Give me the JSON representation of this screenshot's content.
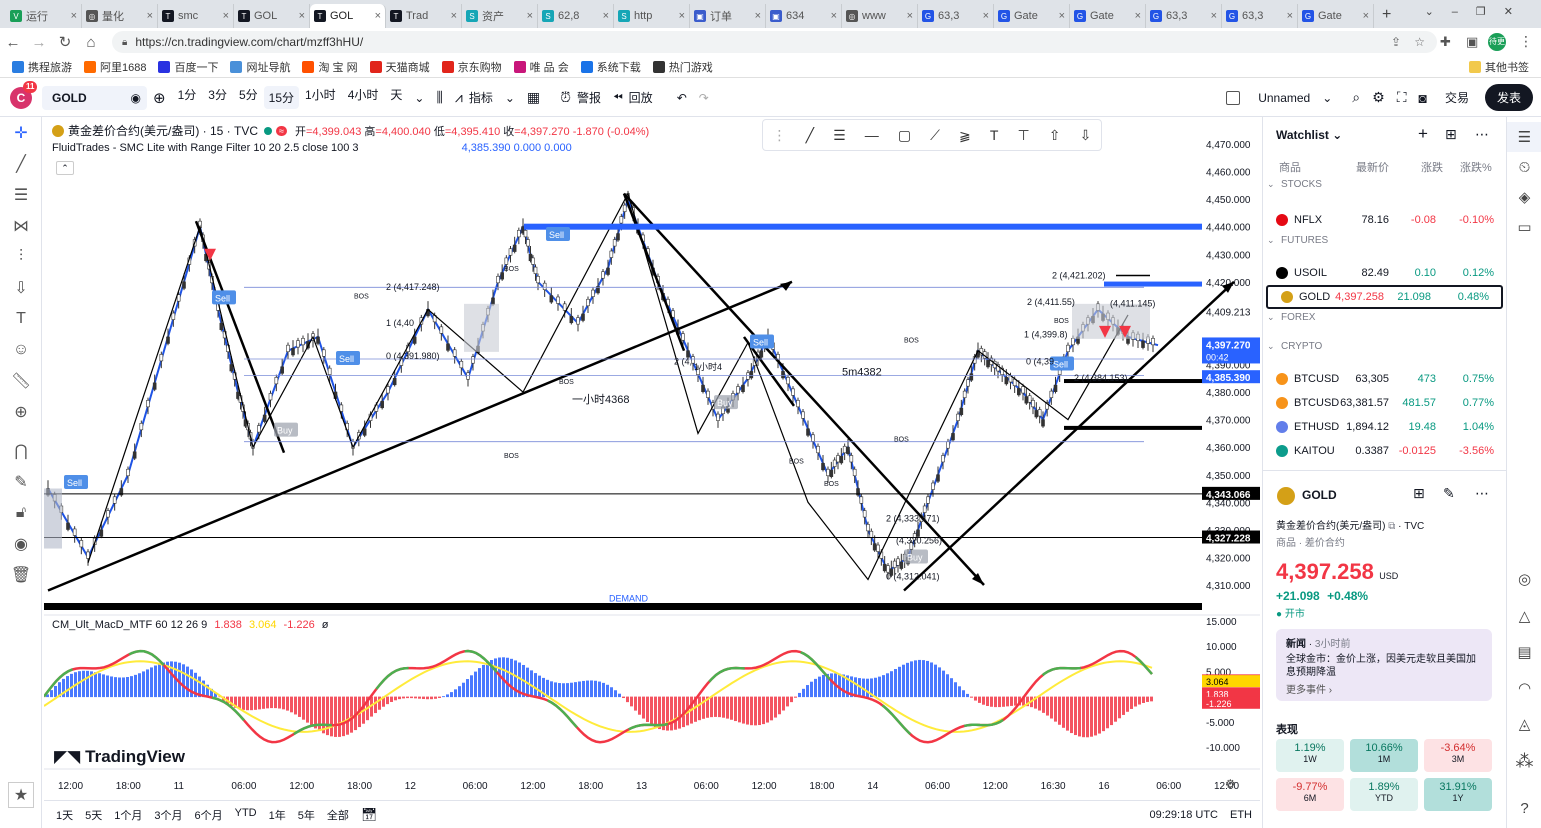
{
  "browser": {
    "tabs": [
      {
        "label": "运行",
        "color": "#1a9f58",
        "glyph": "V"
      },
      {
        "label": "量化",
        "color": "#555",
        "glyph": "◎"
      },
      {
        "label": "smc",
        "color": "#131722",
        "glyph": "T"
      },
      {
        "label": "GOL",
        "color": "#131722",
        "glyph": "T"
      },
      {
        "label": "GOL",
        "color": "#131722",
        "glyph": "T",
        "active": true
      },
      {
        "label": "Trad",
        "color": "#131722",
        "glyph": "T"
      },
      {
        "label": "资产",
        "color": "#16a6b6",
        "glyph": "S"
      },
      {
        "label": "62,8",
        "color": "#16a6b6",
        "glyph": "S"
      },
      {
        "label": "http",
        "color": "#16a6b6",
        "glyph": "S"
      },
      {
        "label": "订单",
        "color": "#3a5ccc",
        "glyph": "▣"
      },
      {
        "label": "634",
        "color": "#3a5ccc",
        "glyph": "▣"
      },
      {
        "label": "www",
        "color": "#555",
        "glyph": "◎"
      },
      {
        "label": "63,3",
        "color": "#2354e6",
        "glyph": "G"
      },
      {
        "label": "Gate",
        "color": "#2354e6",
        "glyph": "G"
      },
      {
        "label": "Gate",
        "color": "#2354e6",
        "glyph": "G"
      },
      {
        "label": "63,3",
        "color": "#2354e6",
        "glyph": "G"
      },
      {
        "label": "63,3",
        "color": "#2354e6",
        "glyph": "G"
      },
      {
        "label": "Gate",
        "color": "#2354e6",
        "glyph": "G"
      }
    ],
    "url": "https://cn.tradingview.com/chart/mzff3hHU/",
    "bookmarks": [
      "携程旅游",
      "阿里1688",
      "百度一下",
      "网址导航",
      "淘 宝 网",
      "天猫商城",
      "京东购物",
      "唯 品 会",
      "系统下载",
      "热门游戏"
    ],
    "bookmarks_other": "其他书签",
    "profile": "待更"
  },
  "toolbar": {
    "badge": "11",
    "symbol": "GOLD",
    "intervals": [
      "1分",
      "3分",
      "5分",
      "15分",
      "1小时",
      "4小时",
      "天"
    ],
    "indicators": "指标",
    "alert": "警报",
    "replay": "回放",
    "layout_name": "Unnamed",
    "trade": "交易",
    "publish": "发表"
  },
  "chart": {
    "title": "黄金差价合约(美元/盎司) · 15 · TVC",
    "ohlc": {
      "o_label": "开",
      "o": "=4,399.043",
      "h_label": "高",
      "h": "=4,400.040",
      "l_label": "低",
      "l": "=4,395.410",
      "c_label": "收",
      "c": "=4,397.270",
      "chg": "-1.870 (-0.04%)"
    },
    "indicator1": "FluidTrades - SMC Lite with Range Filter 10 20 2.5 close 100 3",
    "indicator1_vals": "4,385.390  0.000  0.000",
    "price_ticks": [
      "4,470.000",
      "4,460.000",
      "4,450.000",
      "4,440.000",
      "4,430.000",
      "4,420.000",
      "4,409.213",
      "4,397.302",
      "4,390.000",
      "4,380.000",
      "4,370.000",
      "4,360.000",
      "4,350.000",
      "4,340.000",
      "4,330.000",
      "4,320.000",
      "4,310.000"
    ],
    "price_labels": [
      {
        "text": "4,397.270",
        "sub": "00:42",
        "bg": "#2962ff"
      },
      {
        "text": "4,385.390",
        "bg": "#2962ff"
      },
      {
        "text": "4,343.066",
        "bg": "#000000"
      },
      {
        "text": "4,327.228",
        "bg": "#000000"
      }
    ],
    "annotations": [
      "2 (4,421.202)",
      "2 (4,411.55)",
      "(4,411.145)",
      "1 (4,399.8)",
      "0 (4,39",
      "2 (4,384.153)",
      "2 (4,417.248)",
      "1 (4,40",
      "0 (4,391.980)",
      "5m4382",
      "一小时4368",
      "2 (4,",
      "1小时4",
      "2 (4,333.471)",
      "(4,320.256)",
      "0 (4,312.041)",
      "DEMAND"
    ],
    "labels_bos": "BOS",
    "labels_sell": "Sell",
    "labels_buy": "Buy",
    "macd_title": "CM_Ult_MacD_MTF 60 12 26 9",
    "macd_vals": [
      "1.838",
      "3.064",
      "-1.226",
      "ø"
    ],
    "macd_ticks": [
      "15.000",
      "10.000",
      "5.000",
      "0.000",
      "-5.000",
      "-10.000"
    ],
    "macd_labels": [
      {
        "text": "3.219",
        "bg": "#f23645"
      },
      {
        "text": "3.064",
        "bg": "#ffd600",
        "fg": "#000"
      },
      {
        "text": "1.838",
        "bg": "#f23645"
      },
      {
        "text": "-1.226",
        "bg": "#f23645"
      }
    ],
    "time_ticks": [
      "12:00",
      "18:00",
      "11",
      "06:00",
      "12:00",
      "18:00",
      "12",
      "06:00",
      "12:00",
      "18:00",
      "13",
      "06:00",
      "12:00",
      "18:00",
      "14",
      "06:00",
      "12:00",
      "16:30",
      "16",
      "06:00",
      "12:00"
    ],
    "logo": "TradingView"
  },
  "bottom": {
    "ranges": [
      "1天",
      "5天",
      "1个月",
      "3个月",
      "6个月",
      "YTD",
      "1年",
      "5年",
      "全部"
    ],
    "clock": "09:29:18 UTC",
    "currency": "ETH"
  },
  "watchlist": {
    "title": "Watchlist",
    "cols": [
      "商品",
      "最新价",
      "涨跌",
      "涨跌%"
    ],
    "sections": {
      "stocks": "STOCKS",
      "futures": "FUTURES",
      "forex": "FOREX",
      "crypto": "CRYPTO"
    },
    "rows": [
      {
        "sym": "NFLX",
        "last": "78.16",
        "chg": "-0.08",
        "pct": "-0.10%",
        "up": false,
        "icon": "#e50914"
      },
      {
        "sym": "USOIL",
        "last": "82.49",
        "chg": "0.10",
        "pct": "0.12%",
        "up": true,
        "icon": "#000000"
      },
      {
        "sym": "GOLD",
        "last": "4,397.258",
        "chg": "21.098",
        "pct": "0.48%",
        "up": true,
        "icon": "#d4a017",
        "selected": true
      },
      {
        "sym": "BTCUSD",
        "last": "63,305",
        "chg": "473",
        "pct": "0.75%",
        "up": true,
        "icon": "#f7931a"
      },
      {
        "sym": "BTCUSD",
        "last": "63,381.57",
        "chg": "481.57",
        "pct": "0.77%",
        "up": true,
        "icon": "#f7931a"
      },
      {
        "sym": "ETHUSD",
        "last": "1,894.12",
        "chg": "19.48",
        "pct": "1.04%",
        "up": true,
        "icon": "#627eea"
      },
      {
        "sym": "KAITOU",
        "last": "0.3387",
        "chg": "-0.0125",
        "pct": "-3.56%",
        "up": false,
        "icon": "#0c9c8c"
      }
    ]
  },
  "details": {
    "symbol": "GOLD",
    "name": "黄金差价合约(美元/盎司)",
    "exchange": "TVC",
    "category": "商品 · 差价合约",
    "price": "4,397.258",
    "currency": "USD",
    "change": "+21.098",
    "change_pct": "+0.48%",
    "status": "开市",
    "news_label": "新闻",
    "news_time": "3小时前",
    "news_text": "全球金市：金价上涨，因美元走软且美国加息预期降温",
    "more_events": "更多事件",
    "perf_title": "表现",
    "perf": [
      {
        "v": "1.19%",
        "p": "1W",
        "up": true
      },
      {
        "v": "10.66%",
        "p": "1M",
        "up": true
      },
      {
        "v": "-3.64%",
        "p": "3M",
        "up": false
      },
      {
        "v": "-9.77%",
        "p": "6M",
        "up": false
      },
      {
        "v": "1.89%",
        "p": "YTD",
        "up": true
      },
      {
        "v": "31.91%",
        "p": "1Y",
        "up": true
      }
    ]
  },
  "colors": {
    "up": "#089981",
    "down": "#f23645",
    "blue": "#2962ff",
    "sell": "#4f8fe8"
  }
}
